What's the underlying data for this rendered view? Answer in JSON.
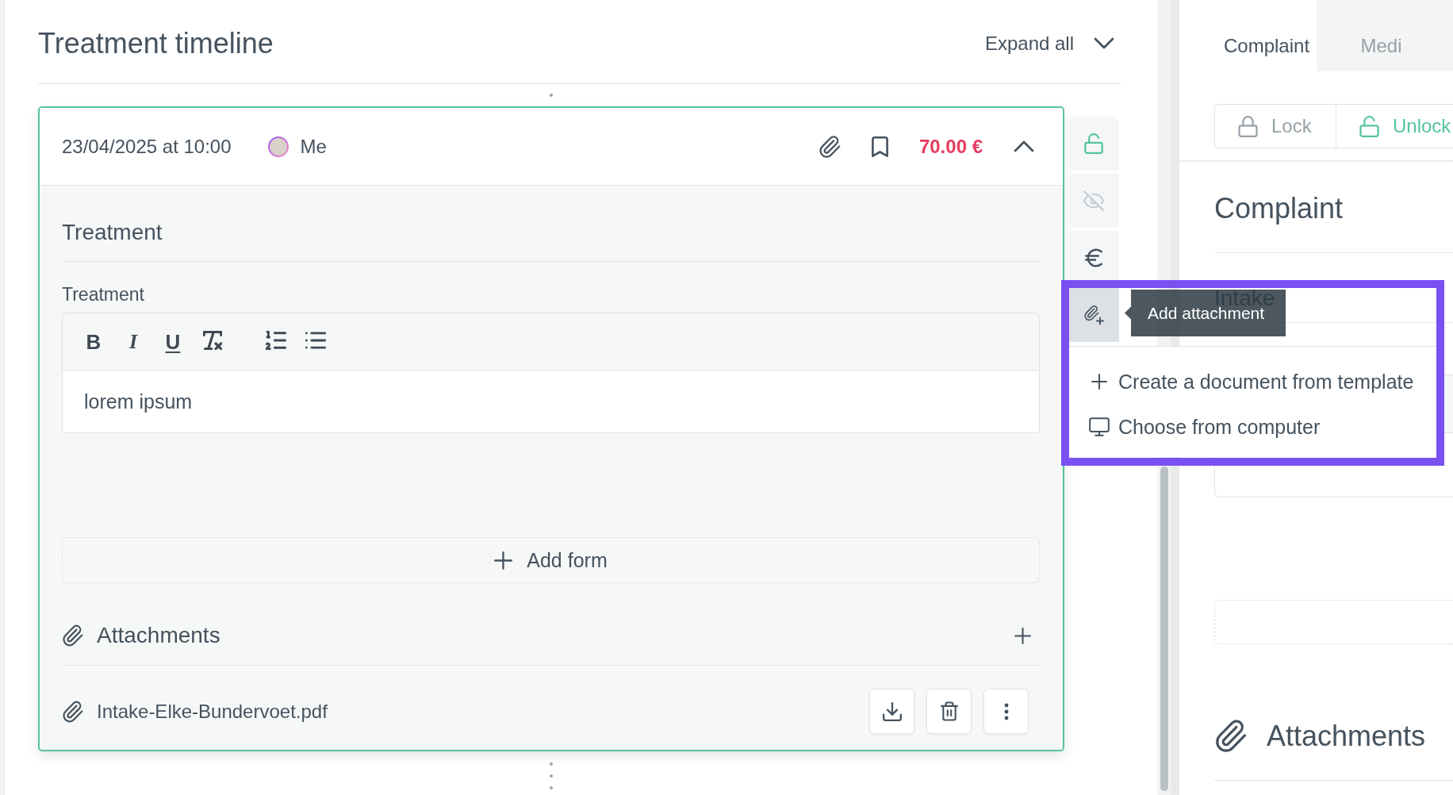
{
  "timeline": {
    "title": "Treatment timeline",
    "expand_all": "Expand all"
  },
  "entry": {
    "date": "23/04/2025 at 10:00",
    "author": "Me",
    "price": "70.00 €",
    "bookmarked": false,
    "expanded": true,
    "section": "Treatment",
    "field": {
      "label": "Treatment",
      "value": "lorem ipsum",
      "toolbar": [
        {
          "kind": "bold",
          "glyph": "B"
        },
        {
          "kind": "italic",
          "glyph": "I"
        },
        {
          "kind": "underline",
          "glyph": "U"
        },
        {
          "kind": "clear"
        },
        {
          "kind": "ordered"
        },
        {
          "kind": "bullet"
        }
      ]
    },
    "add_form": "Add form",
    "attachments": {
      "title": "Attachments",
      "files": [
        {
          "name": "Intake-Elke-Bundervoet.pdf"
        }
      ]
    }
  },
  "side_tools": [
    {
      "kind": "unlock",
      "selected": false,
      "disabled": false
    },
    {
      "kind": "hide",
      "selected": false,
      "disabled": true
    },
    {
      "kind": "price",
      "selected": false,
      "disabled": false
    },
    {
      "kind": "attach",
      "selected": true,
      "disabled": false
    }
  ],
  "tooltip": {
    "text": "Add attachment"
  },
  "attach_menu": [
    {
      "kind": "template",
      "label": "Create a document from template"
    },
    {
      "kind": "computer",
      "label": "Choose from computer"
    }
  ],
  "side_panel": {
    "tabs": [
      {
        "label": "Complaint",
        "selected": true
      },
      {
        "label": "Medi",
        "selected": false
      }
    ],
    "lock_options": [
      {
        "kind": "lock",
        "label": "Lock",
        "selected": false
      },
      {
        "kind": "unlock",
        "label": "Unlock",
        "selected": true
      }
    ],
    "heading": "Complaint",
    "section": "Intake",
    "attachments_title": "Attachments"
  }
}
